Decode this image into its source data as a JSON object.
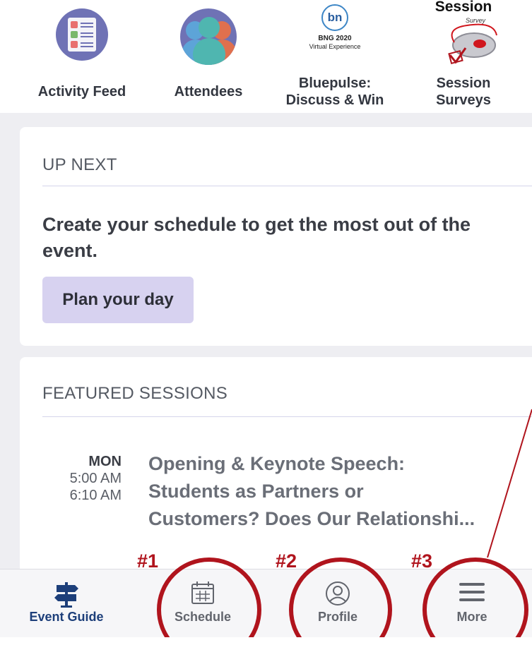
{
  "quick_links": [
    {
      "label": "Activity Feed",
      "icon": "activity-feed-icon"
    },
    {
      "label": "Attendees",
      "icon": "attendees-icon"
    },
    {
      "label": "Bluepulse:\nDiscuss & Win",
      "icon": "bluepulse-logo",
      "logo_text": "bn",
      "logo_line1": "BNG 2020",
      "logo_line2": "Virtual Experience"
    },
    {
      "label": "Session\nSurveys",
      "icon": "session-survey-icon",
      "logo_title": "Session",
      "logo_sub": "Survey"
    }
  ],
  "up_next": {
    "heading": "UP NEXT",
    "message": "Create your schedule to get the most out of the event.",
    "button": "Plan your day"
  },
  "featured": {
    "heading": "FEATURED SESSIONS",
    "sessions": [
      {
        "day": "MON",
        "start": "5:00 AM",
        "end": "6:10 AM",
        "title_lines": [
          "Opening & Keynote Speech:",
          "Students as Partners or",
          "Customers? Does Our Relationshi..."
        ]
      }
    ]
  },
  "tabs": [
    {
      "label": "Event Guide",
      "icon": "signpost-icon",
      "active": true
    },
    {
      "label": "Schedule",
      "icon": "calendar-icon",
      "active": false
    },
    {
      "label": "Profile",
      "icon": "profile-icon",
      "active": false
    },
    {
      "label": "More",
      "icon": "menu-icon",
      "active": false
    }
  ],
  "annotations": [
    "#1",
    "#2",
    "#3"
  ],
  "colors": {
    "accent": "#6f72b5",
    "annotation": "#b0141d",
    "active_tab": "#1d3f7a",
    "button_bg": "#d7d2f0"
  }
}
